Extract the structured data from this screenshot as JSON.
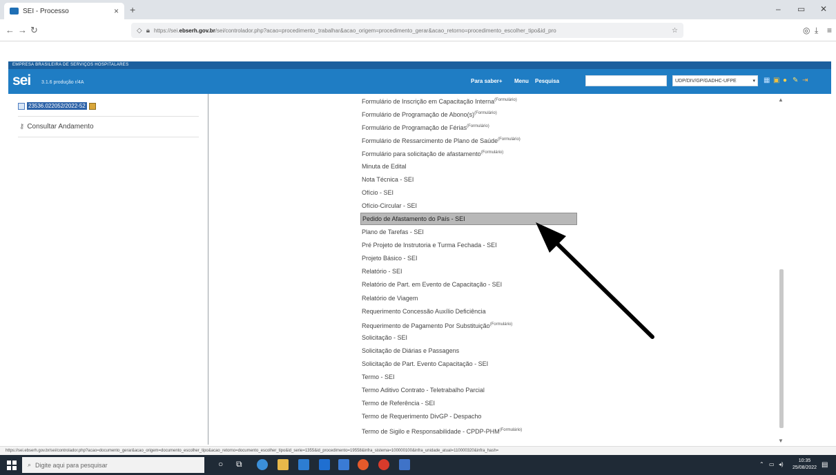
{
  "browser": {
    "tab_title": "SEI - Processo",
    "tab_close": "×",
    "new_tab": "+",
    "url_prefix": "https://sei.",
    "url_domain": "ebserh.gov.br",
    "url_rest": "/sei/controlador.php?acao=procedimento_trabalhar&acao_origem=procedimento_gerar&acao_retorno=procedimento_escolher_tipo&id_pro"
  },
  "sei": {
    "org_name": "EMPRESA BRASILEIRA DE SERVIÇOS HOSPITALARES",
    "logo": "sei",
    "version": "3.1.6 produção r/4A",
    "menu": [
      "Para saber+",
      "Menu",
      "Pesquisa"
    ],
    "unit_selected": "UDP/DIV/GP/GADHC-UFPE",
    "unit_arrow": "▾"
  },
  "left": {
    "process_number": "23536.022052/2022-52",
    "consult_label": "Consultar Andamento"
  },
  "document_types": [
    {
      "label": "Formulário de Inscrição em Capacitação Interna",
      "tag": "(Formulário)"
    },
    {
      "label": "Formulário de Programação de Abono(s)",
      "tag": "(Formulário)"
    },
    {
      "label": "Formulário de Programação de Férias",
      "tag": "(Formulário)"
    },
    {
      "label": "Formulário de Ressarcimento de Plano de Saúde",
      "tag": "(Formulário)"
    },
    {
      "label": "Formulário para solicitação de afastamento",
      "tag": "(Formulário)"
    },
    {
      "label": "Minuta de Edital",
      "tag": ""
    },
    {
      "label": "Nota Técnica - SEI",
      "tag": ""
    },
    {
      "label": "Ofício - SEI",
      "tag": ""
    },
    {
      "label": "Ofício-Circular - SEI",
      "tag": ""
    },
    {
      "label": "Pedido de Afastamento do País - SEI",
      "tag": ""
    },
    {
      "label": "Plano de Tarefas - SEI",
      "tag": ""
    },
    {
      "label": "Pré Projeto de Instrutoria e Turma Fechada - SEI",
      "tag": ""
    },
    {
      "label": "Projeto Básico - SEI",
      "tag": ""
    },
    {
      "label": "Relatório - SEI",
      "tag": ""
    },
    {
      "label": "Relatório de Part. em Evento de Capacitação - SEI",
      "tag": ""
    },
    {
      "label": "Relatório de Viagem",
      "tag": ""
    },
    {
      "label": "Requerimento Concessão Auxílio Deficiência",
      "tag": ""
    },
    {
      "label": "Requerimento de Pagamento Por Substituição",
      "tag": "(Formulário)"
    },
    {
      "label": "Solicitação - SEI",
      "tag": ""
    },
    {
      "label": "Solicitação de Diárias e Passagens",
      "tag": ""
    },
    {
      "label": "Solicitação de Part. Evento Capacitação - SEI",
      "tag": ""
    },
    {
      "label": "Termo - SEI",
      "tag": ""
    },
    {
      "label": "Termo Aditivo Contrato - Teletrabalho Parcial",
      "tag": ""
    },
    {
      "label": "Termo de Referência - SEI",
      "tag": ""
    },
    {
      "label": "Termo de Requerimento DivGP - Despacho",
      "tag": ""
    },
    {
      "label": "Termo de Sigilo e Responsabilidade - CPDP-PHM",
      "tag": "(Formulário)"
    }
  ],
  "highlighted_index": 9,
  "status_url": "https://sei.ebserh.gov.br/sei/controlador.php?acao=documento_gerar&acao_origem=documento_escolher_tipo&acao_retorno=documento_escolher_tipo&id_serie=1355&id_procedimento=19558&infra_sistema=100000100&infra_unidade_atual=110000320&infra_hash=",
  "taskbar": {
    "search_placeholder": "Digite aqui para pesquisar",
    "time": "10:35",
    "date": "25/08/2022"
  },
  "colors": {
    "sei_header": "#1f7dc4",
    "sei_topbar": "#1b5f9e",
    "highlight": "#b8b8b8",
    "taskbar": "#1f2a36"
  }
}
